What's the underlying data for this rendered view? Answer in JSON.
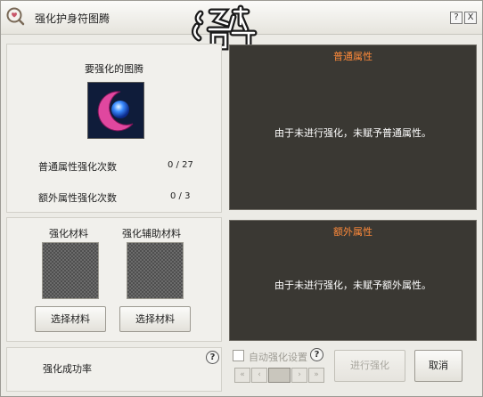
{
  "window": {
    "title": "强化护身符图腾"
  },
  "titlebar": {
    "help_button": "?",
    "close_button": "X"
  },
  "target": {
    "label": "要强化的图腾",
    "stats": [
      {
        "label": "普通属性强化次数",
        "value": "0 / 27"
      },
      {
        "label": "额外属性强化次数",
        "value": "0 / 3"
      }
    ]
  },
  "materials": {
    "material_label": "强化材料",
    "assist_label": "强化辅助材料",
    "select_material_button": "选择材料",
    "select_assist_button": "选择材料"
  },
  "success": {
    "label": "强化成功率"
  },
  "normal_attr": {
    "title": "普通属性",
    "message": "由于未进行强化，未赋予普通属性。"
  },
  "extra_attr": {
    "title": "额外属性",
    "message": "由于未进行强化，未赋予额外属性。"
  },
  "auto": {
    "checkbox_label": "自动强化设置",
    "checked": false
  },
  "pager": {
    "first": "«",
    "prev": "‹",
    "next": "›",
    "last": "»"
  },
  "actions": {
    "enhance_button": "进行强化",
    "cancel_button": "取消"
  },
  "colors": {
    "section_title": "#ff8a3a",
    "dark_panel": "#3a3833"
  }
}
